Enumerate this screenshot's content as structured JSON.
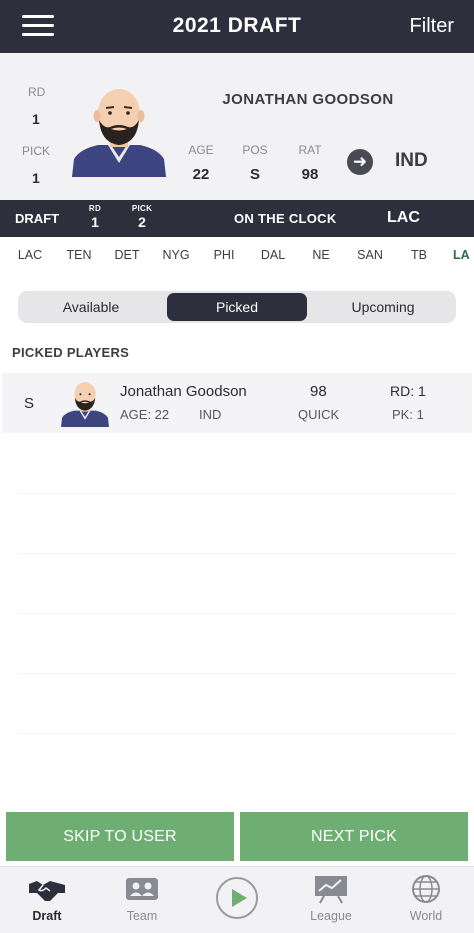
{
  "header": {
    "title": "2021 DRAFT",
    "filter_label": "Filter"
  },
  "player_card": {
    "rd_label": "RD",
    "rd_value": "1",
    "pick_label": "PICK",
    "pick_value": "1",
    "name": "JONATHAN GOODSON",
    "stats": [
      {
        "label": "AGE",
        "value": "22"
      },
      {
        "label": "POS",
        "value": "S"
      },
      {
        "label": "RAT",
        "value": "98"
      }
    ],
    "team": "IND"
  },
  "draft_strip": {
    "draft_label": "DRAFT",
    "rd_label": "RD",
    "rd_value": "1",
    "pick_label": "PICK",
    "pick_value": "2",
    "clock_label": "ON THE CLOCK",
    "team": "LAC"
  },
  "teams": [
    "LAC",
    "TEN",
    "DET",
    "NYG",
    "PHI",
    "DAL",
    "NE",
    "SAN",
    "TB",
    "LA"
  ],
  "segments": [
    {
      "label": "Available"
    },
    {
      "label": "Picked"
    },
    {
      "label": "Upcoming"
    }
  ],
  "active_segment": "Picked",
  "section_title": "PICKED PLAYERS",
  "picked": [
    {
      "pos": "S",
      "name": "Jonathan Goodson",
      "age": "AGE: 22",
      "team": "IND",
      "rating": "98",
      "trait": "QUICK",
      "rd": "RD: 1",
      "pk": "PK: 1"
    }
  ],
  "buttons": {
    "skip": "SKIP TO USER",
    "next": "NEXT PICK"
  },
  "tabbar": [
    {
      "label": "Draft",
      "icon": "handshake-icon"
    },
    {
      "label": "Team",
      "icon": "roster-icon"
    },
    {
      "label": "",
      "icon": "play-icon"
    },
    {
      "label": "League",
      "icon": "chart-board-icon"
    },
    {
      "label": "World",
      "icon": "globe-icon"
    }
  ],
  "colors": {
    "dark": "#2d2f3c",
    "green": "#6fae73",
    "active_team": "#2f6b3c"
  }
}
